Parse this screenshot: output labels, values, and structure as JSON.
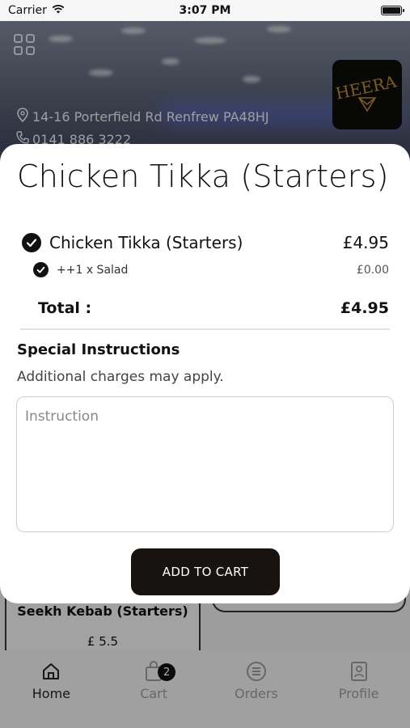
{
  "status_bar": {
    "carrier": "Carrier",
    "time": "3:07 PM"
  },
  "restaurant": {
    "address": "14-16 Porterfield Rd Renfrew PA48HJ",
    "phone": "0141 886 3222",
    "logo_text": "HEERA"
  },
  "background_menu": {
    "item_name": "Seekh Kebab (Starters)",
    "item_price": "£ 5.5"
  },
  "modal": {
    "title": "Chicken Tikka (Starters)",
    "items": [
      {
        "label": "Chicken Tikka (Starters)",
        "price": "£4.95"
      },
      {
        "label": "++1 x Salad",
        "price": "£0.00"
      }
    ],
    "total_label": "Total :",
    "total_value": "£4.95",
    "special_heading": "Special Instructions",
    "special_note": "Additional charges may apply.",
    "instruction_placeholder": "Instruction",
    "add_button": "ADD TO CART"
  },
  "tabs": [
    {
      "label": "Home",
      "icon": "home-icon",
      "active": true
    },
    {
      "label": "Cart",
      "icon": "shopping-bag-icon",
      "badge": "2"
    },
    {
      "label": "Orders",
      "icon": "orders-icon"
    },
    {
      "label": "Profile",
      "icon": "profile-icon"
    }
  ]
}
